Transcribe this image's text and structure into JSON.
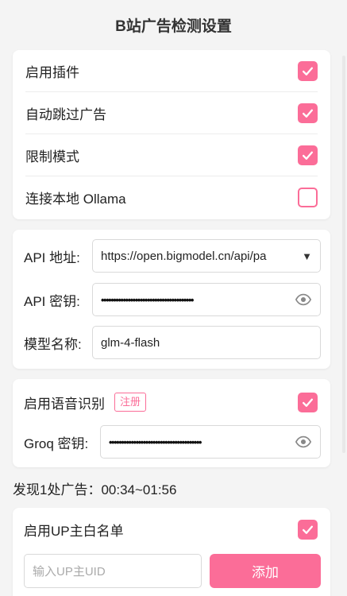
{
  "header": {
    "title": "B站广告检测设置"
  },
  "toggles": [
    {
      "label": "启用插件",
      "checked": true
    },
    {
      "label": "自动跳过广告",
      "checked": true
    },
    {
      "label": "限制模式",
      "checked": true
    },
    {
      "label": "连接本地 Ollama",
      "checked": false
    }
  ],
  "api": {
    "address_label": "API 地址:",
    "address_value": "https://open.bigmodel.cn/api/pa",
    "key_label": "API 密钥:",
    "key_value": "••••••••••••••••••••••••••••••••••••••",
    "model_label": "模型名称:",
    "model_value": "glm-4-flash"
  },
  "speech": {
    "label": "启用语音识别",
    "register_label": "注册",
    "checked": true,
    "groq_label": "Groq 密钥:",
    "groq_value": "••••••••••••••••••••••••••••••••••••••"
  },
  "status": {
    "found_text": "发现1处广告：00:34~01:56"
  },
  "whitelist": {
    "label": "启用UP主白名单",
    "checked": true,
    "input_placeholder": "输入UP主UID",
    "add_label": "添加"
  },
  "colors": {
    "accent": "#fb6d98"
  }
}
